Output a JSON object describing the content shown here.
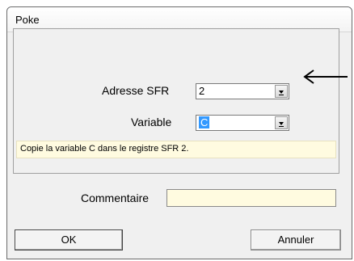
{
  "window": {
    "title": "Poke"
  },
  "form": {
    "sfr_label": "Adresse SFR",
    "sfr_value": "2",
    "variable_label": "Variable",
    "variable_value": "C",
    "info_text": "Copie la variable C dans le registre SFR 2.",
    "comment_label": "Commentaire",
    "comment_value": ""
  },
  "buttons": {
    "ok": "OK",
    "cancel": "Annuler"
  },
  "icons": [
    "dropdown-arrow-icon",
    "left-arrow-icon"
  ],
  "colors": {
    "selection": "#3399ff",
    "info_background": "#fffbe0"
  }
}
